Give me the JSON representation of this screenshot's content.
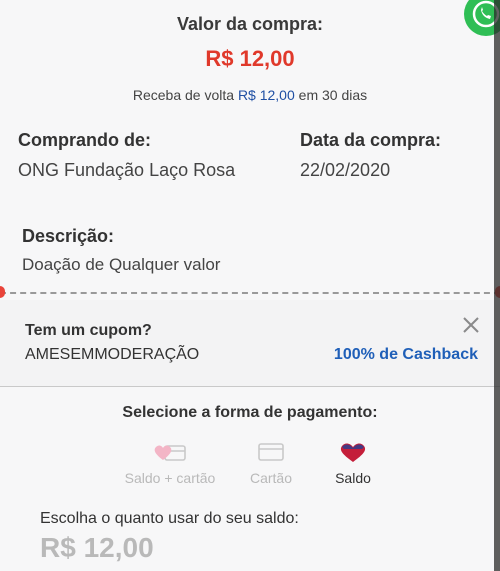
{
  "purchase": {
    "title": "Valor da compra:",
    "amount": "R$ 12,00",
    "cashback_prefix": "Receba de volta",
    "cashback_amount": "R$ 12,00",
    "cashback_suffix": "em 30 dias"
  },
  "details": {
    "buying_from_label": "Comprando de:",
    "buying_from_value": "ONG Fundação Laço Rosa",
    "purchase_date_label": "Data da compra:",
    "purchase_date_value": "22/02/2020",
    "description_label": "Descrição:",
    "description_value": "Doação de Qualquer valor"
  },
  "coupon": {
    "question": "Tem um cupom?",
    "code": "AMESEMMODERAÇÃO",
    "cashback": "100% de Cashback",
    "close_icon": "close-icon"
  },
  "payment": {
    "title": "Selecione a forma de pagamento:",
    "options": [
      {
        "label": "Saldo + cartão",
        "icon": "heart-card-icon",
        "enabled": false
      },
      {
        "label": "Cartão",
        "icon": "card-icon",
        "enabled": false
      },
      {
        "label": "Saldo",
        "icon": "heart-icon",
        "enabled": true
      }
    ]
  },
  "balance": {
    "label": "Escolha o quanto usar do seu saldo:",
    "value": "R$ 12,00"
  },
  "colors": {
    "price_red": "#e0392b",
    "link_blue": "#1f5fb8",
    "disabled_gray": "#b9b9b9"
  }
}
